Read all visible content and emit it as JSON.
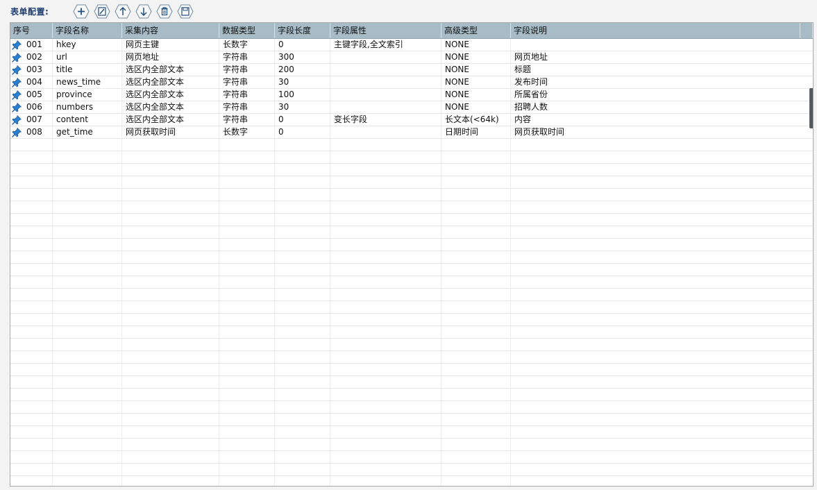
{
  "toolbar": {
    "title": "表单配置:",
    "buttons": [
      {
        "name": "add-button",
        "icon": "plus-icon"
      },
      {
        "name": "edit-button",
        "icon": "edit-icon"
      },
      {
        "name": "move-up-button",
        "icon": "arrow-up-icon"
      },
      {
        "name": "move-down-button",
        "icon": "arrow-down-icon"
      },
      {
        "name": "delete-button",
        "icon": "trash-icon"
      },
      {
        "name": "save-button",
        "icon": "save-icon"
      }
    ]
  },
  "colors": {
    "header_bg": "#a7bcc7",
    "title": "#1f3f73",
    "pin": "#2b7fd1",
    "button_stroke": "#6c8aa3"
  },
  "table": {
    "columns": [
      "序号",
      "字段名称",
      "采集内容",
      "数据类型",
      "字段长度",
      "字段属性",
      "高级类型",
      "字段说明"
    ],
    "rows": [
      [
        "001",
        "hkey",
        "网页主键",
        "长数字",
        "0",
        "主键字段,全文索引",
        "NONE",
        ""
      ],
      [
        "002",
        "url",
        "网页地址",
        "字符串",
        "300",
        "",
        "NONE",
        "网页地址"
      ],
      [
        "003",
        "title",
        "选区内全部文本",
        "字符串",
        "200",
        "",
        "NONE",
        "标题"
      ],
      [
        "004",
        "news_time",
        "选区内全部文本",
        "字符串",
        "30",
        "",
        "NONE",
        "发布时间"
      ],
      [
        "005",
        "province",
        "选区内全部文本",
        "字符串",
        "100",
        "",
        "NONE",
        "所属省份"
      ],
      [
        "006",
        "numbers",
        "选区内全部文本",
        "字符串",
        "30",
        "",
        "NONE",
        "招聘人数"
      ],
      [
        "007",
        "content",
        "选区内全部文本",
        "字符串",
        "0",
        "变长字段",
        "长文本(<64k)",
        "内容"
      ],
      [
        "008",
        "get_time",
        "网页获取时间",
        "长数字",
        "0",
        "",
        "日期时间",
        "网页获取时间"
      ]
    ]
  }
}
